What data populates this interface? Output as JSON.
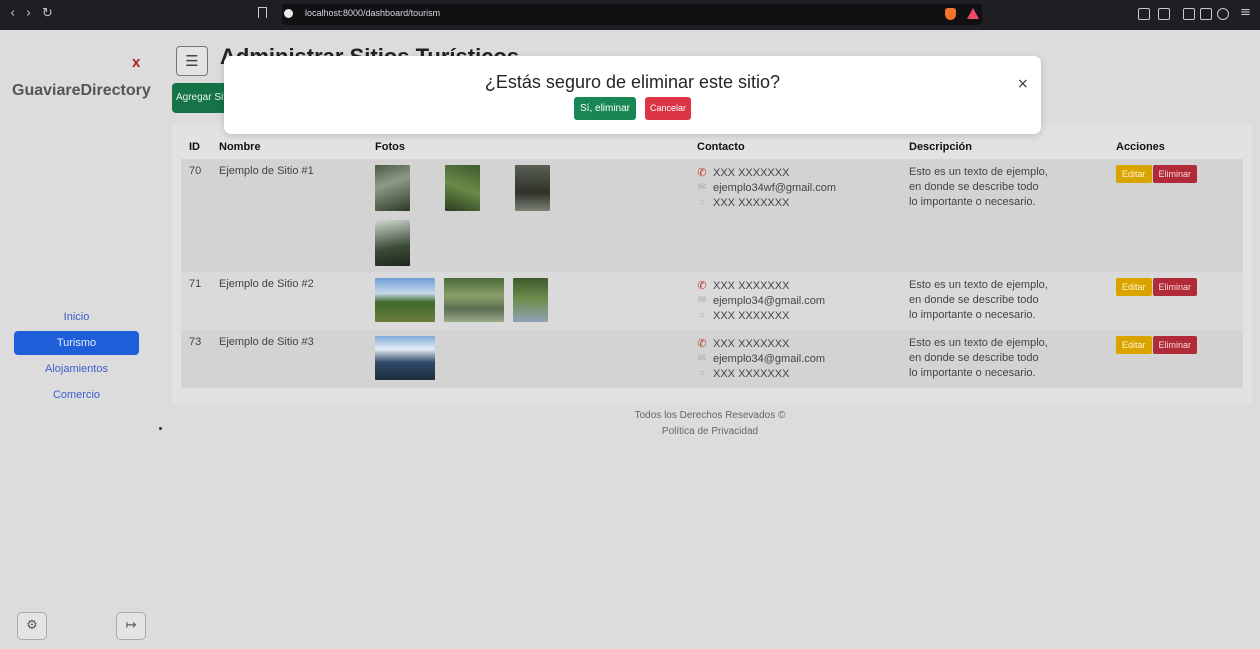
{
  "browser": {
    "url": "localhost:8000/dashboard/tourism"
  },
  "sidebar": {
    "close_label": "x",
    "brand": "GuaviareDirectory",
    "items": [
      {
        "label": "Inicio"
      },
      {
        "label": "Turismo"
      },
      {
        "label": "Alojamientos"
      },
      {
        "label": "Comercio"
      }
    ],
    "active_color": "#1e5ed8"
  },
  "header": {
    "title": "Administrar Sitios Turísticos",
    "add_button": "Agregar Sitio"
  },
  "table": {
    "columns": [
      "ID",
      "Nombre",
      "Fotos",
      "Contacto",
      "Descripción",
      "Acciones"
    ],
    "rows": [
      {
        "id": "70",
        "nombre": "Ejemplo de Sitio #1",
        "photo_count": 4,
        "phone": "XXX XXXXXXX",
        "email": "ejemplo34wf@gmail.com",
        "whatsapp": "XXX XXXXXXX",
        "desc1": "Esto es un texto de ejemplo,",
        "desc2": "en donde se describe todo",
        "desc3": "lo importante o necesario.",
        "edit": "Editar",
        "delete": "Eliminar"
      },
      {
        "id": "71",
        "nombre": "Ejemplo de Sitio #2",
        "photo_count": 3,
        "phone": "XXX XXXXXXX",
        "email": "ejemplo34@gmail.com",
        "whatsapp": "XXX XXXXXXX",
        "desc1": "Esto es un texto de ejemplo,",
        "desc2": "en donde se describe todo",
        "desc3": "lo importante o necesario.",
        "edit": "Editar",
        "delete": "Eliminar"
      },
      {
        "id": "73",
        "nombre": "Ejemplo de Sitio #3",
        "photo_count": 1,
        "phone": "XXX XXXXXXX",
        "email": "ejemplo34@gmail.com",
        "whatsapp": "XXX XXXXXXX",
        "desc1": "Esto es un texto de ejemplo,",
        "desc2": "en donde se describe todo",
        "desc3": "lo importante o necesario.",
        "edit": "Editar",
        "delete": "Eliminar"
      }
    ]
  },
  "footer": {
    "rights": "Todos los Derechos Resevados ©",
    "privacy": "Política de Privacidad"
  },
  "modal": {
    "title": "¿Estás seguro de eliminar este sitio?",
    "confirm": "Sí, eliminar",
    "cancel": "Cancelar",
    "close": "×"
  },
  "colors": {
    "confirm": "#198754",
    "cancel": "#dc3545",
    "edit": "#d9a400",
    "delete": "#b02a37"
  }
}
